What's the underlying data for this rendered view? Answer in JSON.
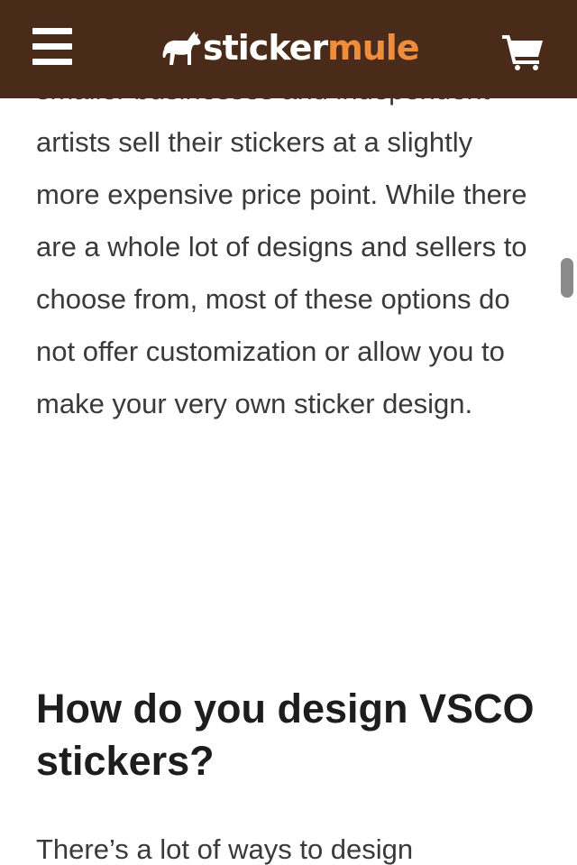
{
  "header": {
    "logo_part1": "sticker",
    "logo_part2": "mule",
    "menu_icon": "hamburger-menu-icon",
    "cart_icon": "shopping-cart-icon",
    "background_color": "#4a2a19",
    "accent_color": "#ee8e3d"
  },
  "article": {
    "paragraph_1": "smaller businesses and independent artists sell their stickers at a slightly more expensive price point. While there are a whole lot of designs and sellers to choose from, most of these options do not offer customization or allow you to make your very own sticker design.",
    "heading": "How do you design VSCO stickers?",
    "paragraph_2": "There’s a lot of ways to design"
  }
}
